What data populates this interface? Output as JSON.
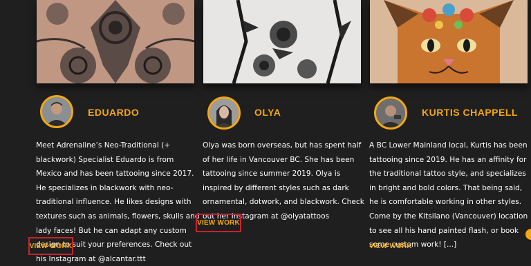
{
  "artists": [
    {
      "name": "EDUARDO",
      "bio": "Meet Adrenaline’s Neo-Traditional (+ blackwork) Specialist Eduardo is from Mexico and has been tattooing since 2017. He specializes in blackwork with neo-traditional influence. He likes designs with textures such as animals, flowers, skulls and lady faces! But he can adapt any custom design to suit your preferences. Check out his Instagram at @alcantar.ttt",
      "button": "VIEW WORK"
    },
    {
      "name": "OLYA",
      "bio": "Olya was born overseas, but has spent half of her life in Vancouver BC. She has been tattooing since summer 2019. Olya is inspired by different styles such as dark ornamental, dotwork, and blackwork. Check out her Instagram at @olyatattoos",
      "button": "VIEW WORK"
    },
    {
      "name": "KURTIS CHAPPELL",
      "bio": "A BC Lower Mainland local, Kurtis has been tattooing since 2019. He has an affinity for the traditional tattoo style, and specializes in bright and bold colors. That being said, he is comfortable working in other styles. Come by the Kitsilano (Vancouver) location to see all his hand painted flash, or book some custom work! [...]",
      "button": "VIEW WORK"
    }
  ],
  "colors": {
    "background": "#1f1f1f",
    "accent": "#f3a712",
    "highlight": "#c8232c",
    "text": "#ffffff"
  }
}
